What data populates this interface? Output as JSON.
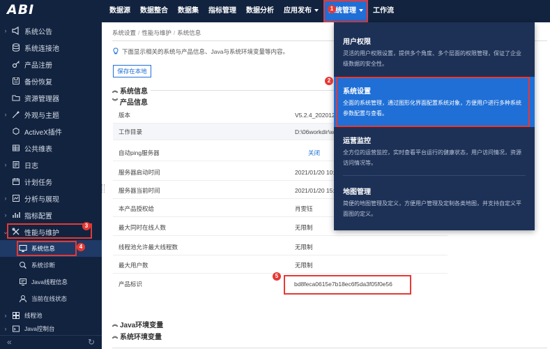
{
  "app": {
    "logo": "ABI"
  },
  "nav": {
    "items": [
      "数据源",
      "数据整合",
      "数据集",
      "指标管理",
      "数据分析",
      "应用发布",
      "系统管理",
      "工作流"
    ],
    "active_index": 6
  },
  "sidebar": {
    "items": [
      {
        "label": "系统公告",
        "icon": "megaphone-icon",
        "expandable": true
      },
      {
        "label": "系统连接池",
        "icon": "database-icon",
        "expandable": false
      },
      {
        "label": "产品注册",
        "icon": "key-icon",
        "expandable": false
      },
      {
        "label": "备份恢复",
        "icon": "backup-icon",
        "expandable": false
      },
      {
        "label": "资源管理器",
        "icon": "folder-icon",
        "expandable": false
      },
      {
        "label": "外观与主题",
        "icon": "theme-icon",
        "expandable": true
      },
      {
        "label": "ActiveX插件",
        "icon": "plugin-icon",
        "expandable": false
      },
      {
        "label": "公共维表",
        "icon": "table-icon",
        "expandable": false
      },
      {
        "label": "日志",
        "icon": "log-icon",
        "expandable": true
      },
      {
        "label": "计划任务",
        "icon": "calendar-icon",
        "expandable": false
      },
      {
        "label": "分析与展现",
        "icon": "chart-icon",
        "expandable": true
      },
      {
        "label": "指标配置",
        "icon": "indicator-icon",
        "expandable": true
      },
      {
        "label": "性能与维护",
        "icon": "wrench-icon",
        "expandable": true,
        "expanded": true
      }
    ],
    "subitems": [
      {
        "label": "系统信息",
        "icon": "monitor-icon",
        "current": true
      },
      {
        "label": "系统诊断",
        "icon": "diagnose-icon"
      },
      {
        "label": "Java线程信息",
        "icon": "thread-icon"
      },
      {
        "label": "当前在线状态",
        "icon": "user-icon"
      },
      {
        "label": "线程池",
        "icon": "pool-icon",
        "expandable": true
      },
      {
        "label": "Java控制台",
        "icon": "console-icon",
        "expandable": true
      }
    ]
  },
  "breadcrumb": [
    "系统设置",
    "性能与维护",
    "系统信息"
  ],
  "tip": "下面显示相关的系统与产品信息、Java与系统环境变量等内容。",
  "save_label": "保存在本地",
  "sections": {
    "system_info": "系统信息",
    "product_info": "产品信息",
    "java_env": "Java环境变量",
    "sys_env": "系统环境变量"
  },
  "product_rows": [
    {
      "key": "版本",
      "value": "V5.2.4_2020121"
    },
    {
      "key": "工作目录",
      "value": "D:\\06workdir\\w"
    },
    {
      "key": "自动ping服务器",
      "value": "关闭",
      "link": true
    },
    {
      "key": "服务器启动时间",
      "value": "2021/01/20 10:"
    },
    {
      "key": "服务器当前时间",
      "value": "2021/01/20 15:"
    },
    {
      "key": "本产品授权给",
      "value": "肖雯钰"
    },
    {
      "key": "最大同时在线人数",
      "value": "无限制"
    },
    {
      "key": "线程池允许最大线程数",
      "value": "无限制"
    },
    {
      "key": "最大用户数",
      "value": "无限制"
    },
    {
      "key": "产品标识",
      "value": "bd8feca0615e7b18ec6f5da3f05f0e56"
    }
  ],
  "dropdown": [
    {
      "title": "用户权限",
      "desc": "灵活的用户权限设置，提供多个角度、多个层面的权限管理，保证了企业级数据的安全性。"
    },
    {
      "title": "系统设置",
      "desc": "全面的系统管理，通过图形化界面配置系统对象，方便用户进行多种系统参数配置与查看。",
      "selected": true
    },
    {
      "title": "运营监控",
      "desc": "全方位的运营监控，实时查看平台运行的健康状态，用户访问情况，资源访问情况等。"
    },
    {
      "title": "地图管理",
      "desc": "简便的地图管理及定义，方便用户管理及定制各类地图，并支持自定义平面图的定义。"
    }
  ],
  "badges": [
    "1",
    "2",
    "3",
    "4",
    "5"
  ],
  "colors": {
    "nav_bg": "#12233f",
    "accent": "#1f6fd6",
    "highlight": "#e53935",
    "panel_bg": "#1d3157"
  }
}
